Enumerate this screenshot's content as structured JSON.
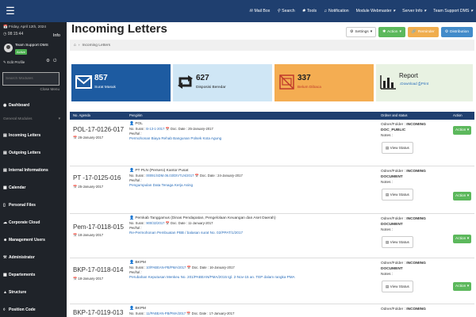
{
  "topbar": {
    "menu_icon": "hamburger-icon",
    "items": [
      {
        "icon": "mail-icon",
        "label": "Mail Box"
      },
      {
        "icon": "search-icon",
        "label": "Search"
      },
      {
        "icon": "tools-icon",
        "label": "Tools"
      },
      {
        "icon": "bell-icon",
        "label": "Notification"
      },
      {
        "icon": "caret-down-icon",
        "label": "Module Webmaster"
      },
      {
        "icon": "caret-down-icon",
        "label": "Server Info"
      },
      {
        "icon": "caret-down-icon",
        "label": "Team Support DMS"
      }
    ]
  },
  "sidebar": {
    "date": "Friday, April 12th, 2024",
    "time": "08:15:44",
    "info_label": "Info",
    "user_name": "Team Support DMS",
    "user_status": "Active",
    "edit_profile": "Edit Profile",
    "search_placeholder": "Search Modules",
    "close_menu": "Close Menu",
    "dashboard": "Dashboard",
    "general_modules": "General Modules",
    "items": [
      {
        "label": "Incoming Letters",
        "icon": "inbox-icon"
      },
      {
        "label": "Outgoing Letters",
        "icon": "send-icon"
      },
      {
        "label": "Internal Informations",
        "icon": "list-icon"
      },
      {
        "label": "Calendar",
        "icon": "calendar-icon"
      },
      {
        "label": "Personal Files",
        "icon": "folder-icon"
      },
      {
        "label": "Corporate Cloud",
        "icon": "cloud-icon"
      },
      {
        "label": "Management Users",
        "icon": "users-icon"
      },
      {
        "label": "Administrator",
        "icon": "wrench-icon"
      },
      {
        "label": "Departements",
        "icon": "building-icon"
      },
      {
        "label": "Structure",
        "icon": "sitemap-icon"
      },
      {
        "label": "Position Code",
        "icon": "tag-icon"
      }
    ]
  },
  "page": {
    "title": "Incoming Letters",
    "buttons": {
      "settings": "Settings",
      "action": "Action",
      "reminder": "Reminder",
      "distribution": "Distribution"
    },
    "breadcrumb": "Incoming Letters"
  },
  "tiles": [
    {
      "num": "857",
      "label": "Surat Masuk"
    },
    {
      "num": "627",
      "label": "Disposisi Beredar"
    },
    {
      "num": "337",
      "label": "Belum Dibaca"
    },
    {
      "num": "Report",
      "label": "Download",
      "label2": "Print"
    }
  ],
  "table": {
    "headers": [
      "No. Agenda",
      "Pengirim",
      "Ordner and status",
      "Action"
    ],
    "rows": [
      {
        "no": "POL-17-0126-017",
        "date": "26-January-2017",
        "sender": "POL",
        "no_surat_label": "No. Surat :",
        "no_surat": "B-13-1-2017",
        "doc_date_label": "Doc. Date :",
        "doc_date": "25-January-2017",
        "perihal_label": "Perihal :",
        "perihal": "Permohonan Biaya Rehab Bangunan Polsek Kota Agung",
        "ordner_label": "Odner/Folder :",
        "ordner": "INCOMING",
        "folder": "DOC_PUBLIC",
        "notes": "Notes :",
        "view": "View Status",
        "action": "Action"
      },
      {
        "no": "PT -17-0125-016",
        "date": "25-January-2017",
        "sender": "PT PLN (Persero) Kantor Pusat",
        "no_surat_label": "No. Surat :",
        "no_surat": "00091/SDM.06.03/DIVTLN/2017",
        "doc_date_label": "Doc. Date :",
        "doc_date": "24-January-2017",
        "perihal_label": "Perihal :",
        "perihal": "Pengumpulan Data Tenaga Kerja Asing",
        "ordner_label": "Odner/Folder :",
        "ordner": "INCOMING",
        "folder": "DOCUMENT",
        "notes": "Notes :",
        "view": "View Status",
        "action": "Action"
      },
      {
        "no": "Pem-17-0118-015",
        "date": "18-January-2017",
        "sender": "Pemkab Tanggamus (Dinas Pendapatan, Pengelolaan Keuangan dan Aset Daerah)",
        "no_surat_label": "No. Surat :",
        "no_surat": "900/32/2017",
        "doc_date_label": "Doc. Date :",
        "doc_date": "11-January-2017",
        "perihal_label": "Perihal :",
        "perihal": "Re-Permohonan Pembuatan PBB / balasan surat No. 02/PPAT/1/2017",
        "ordner_label": "Odner/Folder :",
        "ordner": "INCOMING",
        "folder": "DOCUMENT",
        "notes": "Notes :",
        "view": "View Status",
        "action": "Action"
      },
      {
        "no": "BKP-17-0118-014",
        "date": "18-January-2017",
        "sender": "BKPM",
        "no_surat_label": "No. Surat :",
        "no_surat": "10/PABEAN-PB/PMA/2017",
        "doc_date_label": "Doc. Date :",
        "doc_date": "16-January-2017",
        "perihal_label": "Perihal :",
        "perihal": "Perubahan Keputusan Menkeu No. 201/PABEAN/PMA/2015 tgl. 2-Nov-15 an. TEP dalam rangka PMA",
        "ordner_label": "Odner/Folder :",
        "ordner": "INCOMING",
        "folder": "DOCUMENT",
        "notes": "Notes :",
        "view": "View Status",
        "action": "Action"
      },
      {
        "no": "BKP-17-0119-013",
        "date": "",
        "sender": "BKPM",
        "no_surat_label": "No. Surat :",
        "no_surat": "11/PABEAN-PB/PMA/2017",
        "doc_date_label": "Doc. Date :",
        "doc_date": "17-January-2017",
        "perihal_label": "",
        "perihal": "",
        "ordner_label": "Odner/Folder :",
        "ordner": "INCOMING",
        "folder": "",
        "notes": "",
        "view": "",
        "action": ""
      }
    ]
  }
}
